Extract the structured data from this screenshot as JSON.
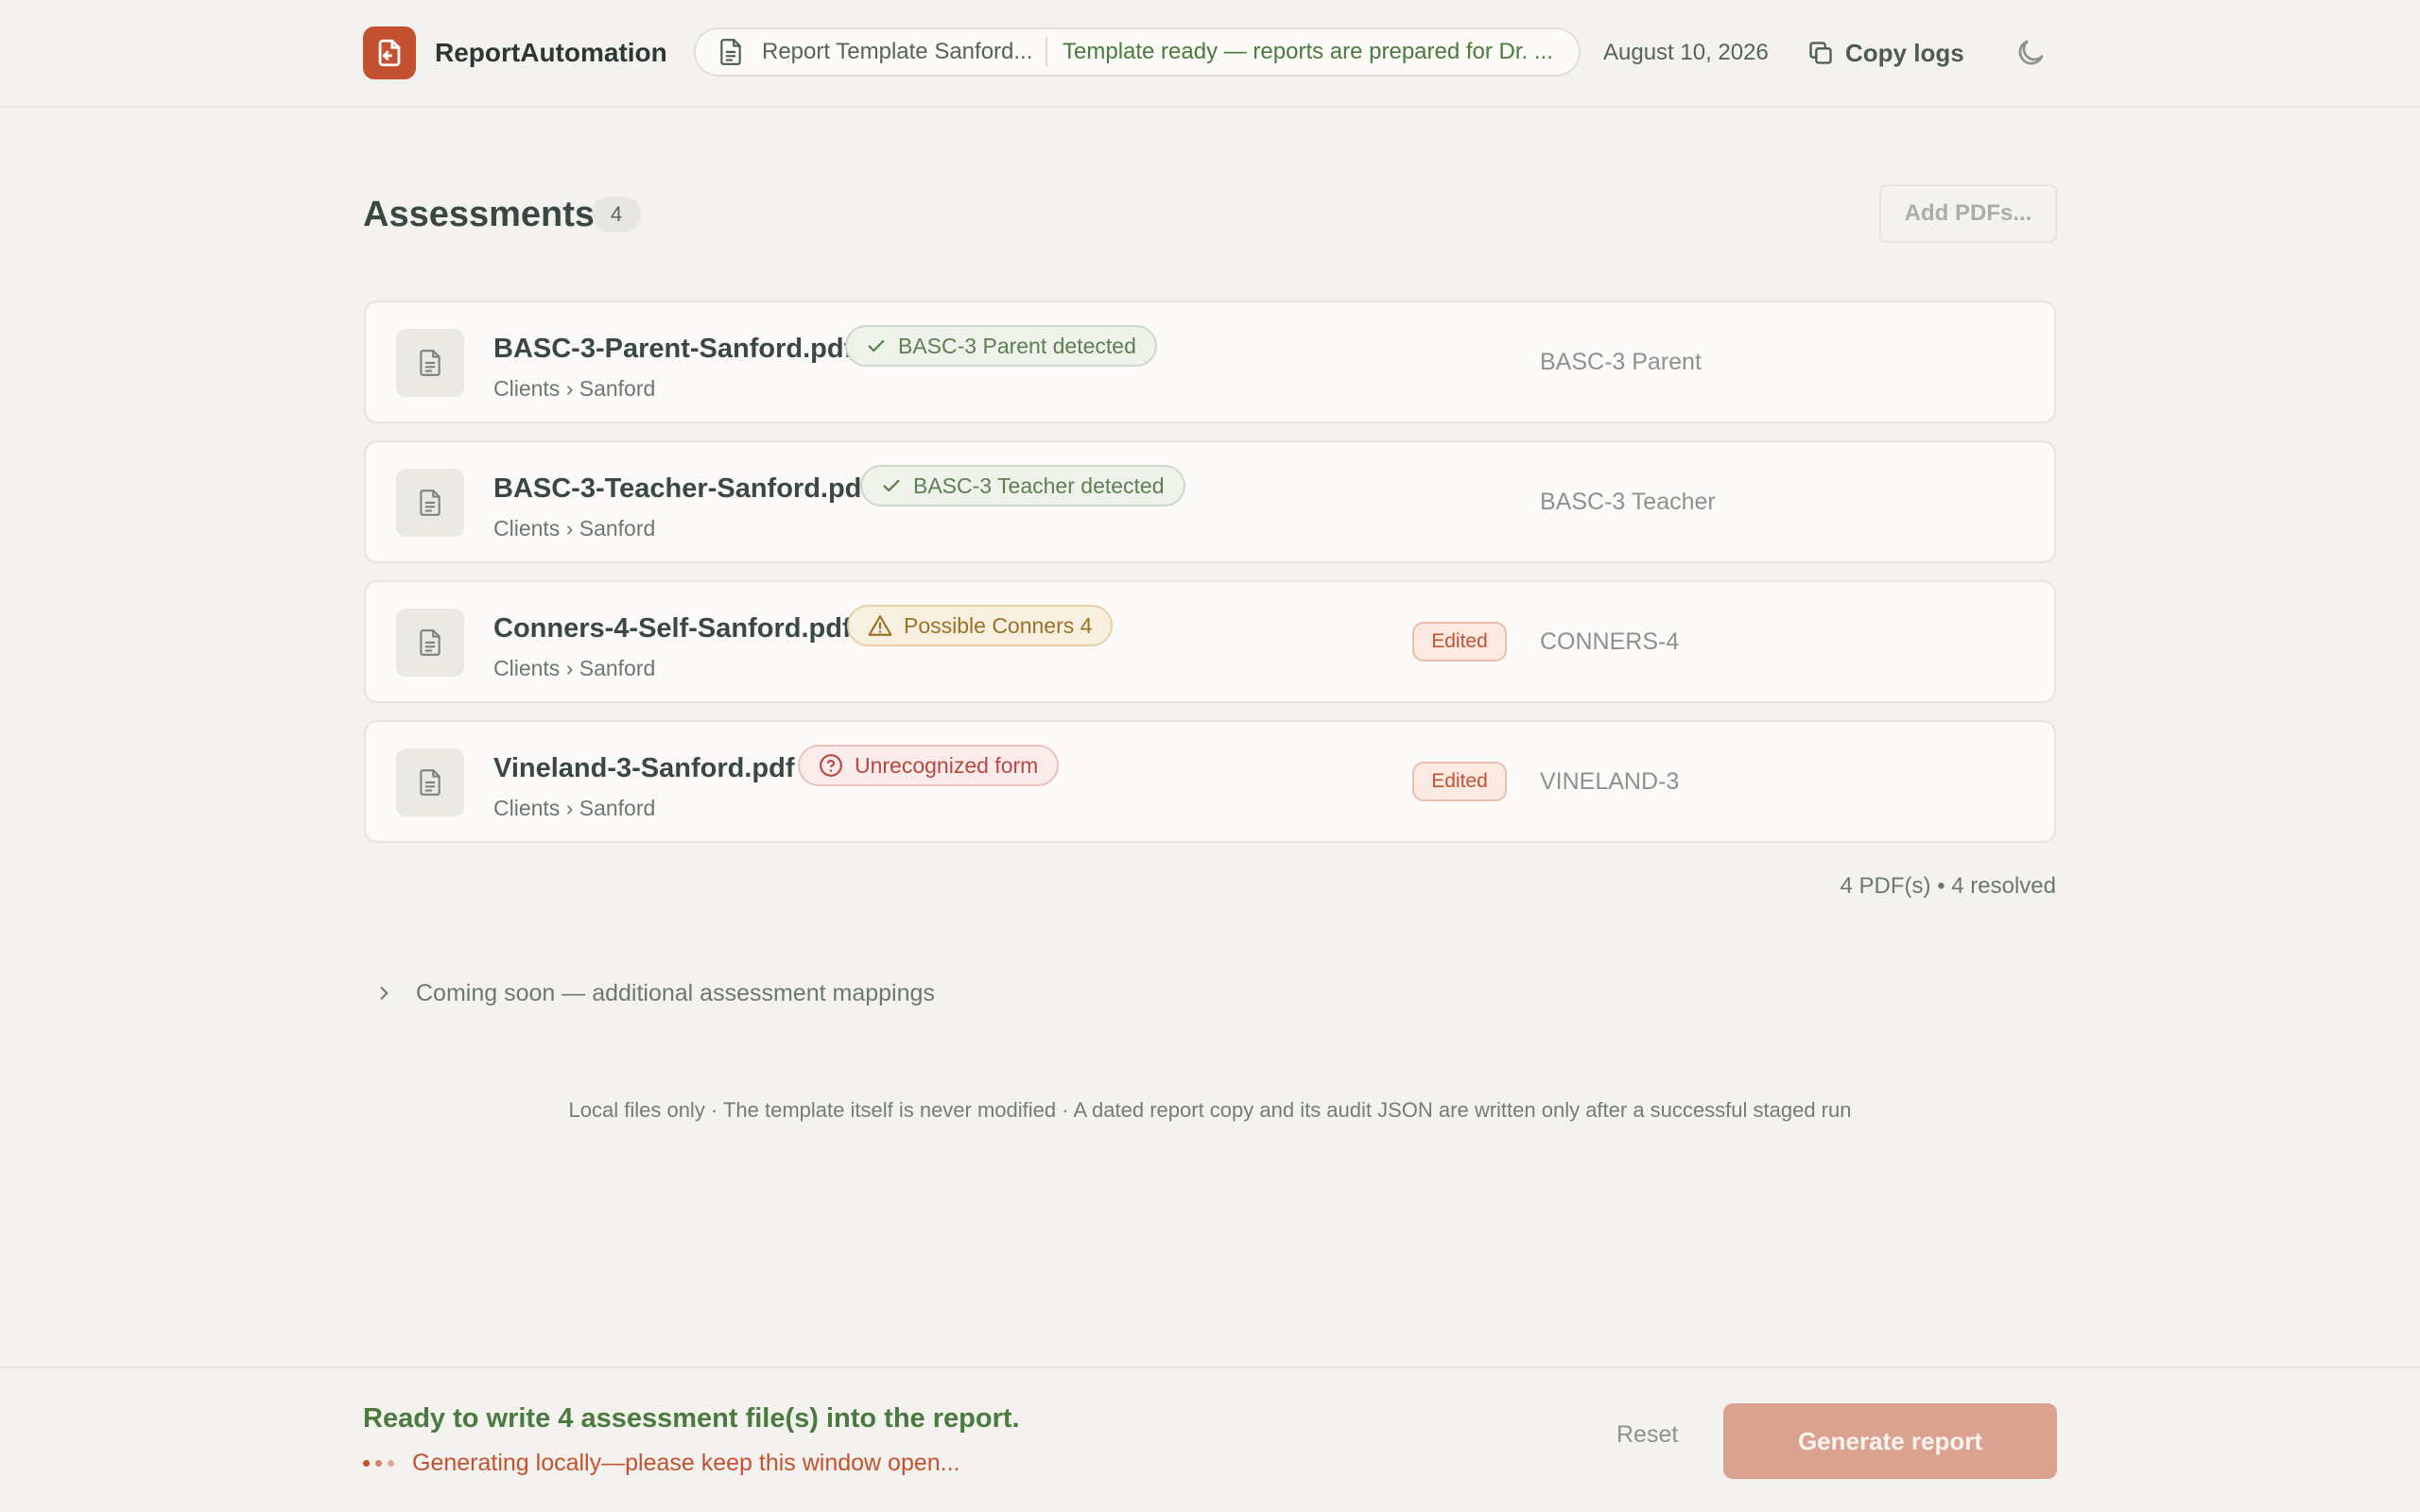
{
  "app": {
    "name": "ReportAutomation",
    "brand_color": "#c4512f"
  },
  "header": {
    "template_name": "Report Template Sanford....",
    "template_status": "Template ready — reports are prepared for Dr. ...",
    "date": "August 10, 2026",
    "copy_logs_label": "Copy logs",
    "theme_icon": "moon-icon"
  },
  "assessments": {
    "title": "Assessments",
    "count": "4",
    "add_pdfs_label": "Add PDFs...",
    "files": [
      {
        "name": "BASC-3-Parent-Sanford.pdf",
        "path": "Clients › Sanford",
        "tag": "BASC-3 Parent detected",
        "tag_kind": "ok",
        "edited": "",
        "form_type": "BASC-3 Parent"
      },
      {
        "name": "BASC-3-Teacher-Sanford.pdf",
        "path": "Clients › Sanford",
        "tag": "BASC-3 Teacher detected",
        "tag_kind": "ok",
        "edited": "",
        "form_type": "BASC-3 Teacher"
      },
      {
        "name": "Conners-4-Self-Sanford.pdf",
        "path": "Clients › Sanford",
        "tag": "Possible Conners 4",
        "tag_kind": "warn",
        "edited": "Edited",
        "form_type": "CONNERS-4"
      },
      {
        "name": "Vineland-3-Sanford.pdf",
        "path": "Clients › Sanford",
        "tag": "Unrecognized form",
        "tag_kind": "err",
        "edited": "Edited",
        "form_type": "VINELAND-3"
      }
    ],
    "summary": "4 PDF(s) • 4 resolved"
  },
  "coming_soon": "Coming soon — additional assessment mappings",
  "footer_note": "Local files only · The template itself is never modified · A dated report copy and its audit JSON are written only after a successful staged run",
  "bottom": {
    "ready_message": "Ready to write 4 assessment file(s) into the report.",
    "generating_message": "Generating locally—please keep this window open...",
    "reset_label": "Reset",
    "generate_label": "Generate report"
  }
}
